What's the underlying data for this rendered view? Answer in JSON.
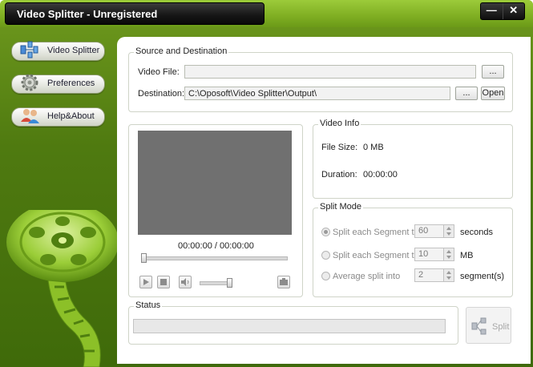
{
  "window": {
    "title": "Video Splitter - Unregistered",
    "minimize": "—",
    "close": "✕"
  },
  "sidebar": {
    "items": [
      {
        "label": "Video Splitter",
        "icon": "splitter-icon"
      },
      {
        "label": "Preferences",
        "icon": "gear-icon"
      },
      {
        "label": "Help&About",
        "icon": "people-icon"
      }
    ]
  },
  "source": {
    "group_title": "Source and Destination",
    "video_file_label": "Video File:",
    "video_file_value": "",
    "browse1": "...",
    "destination_label": "Destination:",
    "destination_value": "C:\\Oposoft\\Video Splitter\\Output\\",
    "browse2": "...",
    "open": "Open"
  },
  "player": {
    "time": "00:00:00 / 00:00:00"
  },
  "video_info": {
    "group_title": "Video Info",
    "file_size_label": "File Size:",
    "file_size_value": "0 MB",
    "duration_label": "Duration:",
    "duration_value": "00:00:00"
  },
  "split_mode": {
    "group_title": "Split Mode",
    "options": [
      {
        "label": "Split each Segment to",
        "value": "60",
        "unit": "seconds",
        "selected": true
      },
      {
        "label": "Split each Segment to",
        "value": "10",
        "unit": "MB",
        "selected": false
      },
      {
        "label": "Average split into",
        "value": "2",
        "unit": "segment(s)",
        "selected": false
      }
    ]
  },
  "status": {
    "group_title": "Status",
    "progress": 0
  },
  "split_button": "Split"
}
